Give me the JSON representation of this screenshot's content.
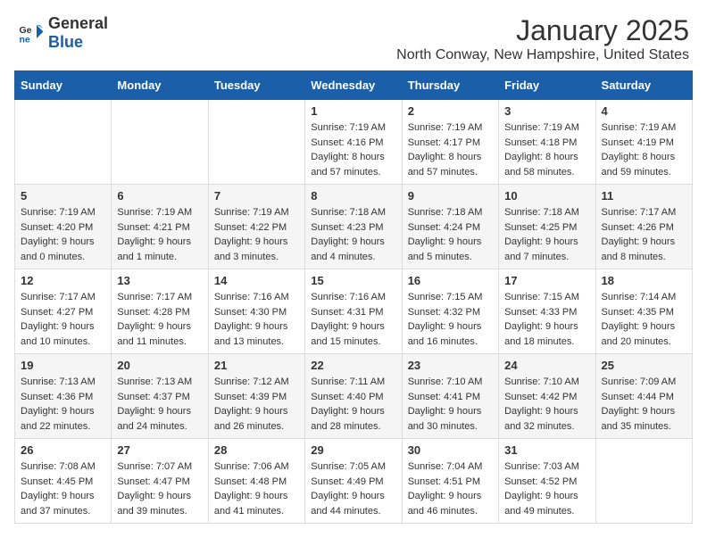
{
  "header": {
    "logo_general": "General",
    "logo_blue": "Blue",
    "month_title": "January 2025",
    "location": "North Conway, New Hampshire, United States"
  },
  "weekdays": [
    "Sunday",
    "Monday",
    "Tuesday",
    "Wednesday",
    "Thursday",
    "Friday",
    "Saturday"
  ],
  "weeks": [
    [
      {
        "day": "",
        "detail": ""
      },
      {
        "day": "",
        "detail": ""
      },
      {
        "day": "",
        "detail": ""
      },
      {
        "day": "1",
        "detail": "Sunrise: 7:19 AM\nSunset: 4:16 PM\nDaylight: 8 hours and 57 minutes."
      },
      {
        "day": "2",
        "detail": "Sunrise: 7:19 AM\nSunset: 4:17 PM\nDaylight: 8 hours and 57 minutes."
      },
      {
        "day": "3",
        "detail": "Sunrise: 7:19 AM\nSunset: 4:18 PM\nDaylight: 8 hours and 58 minutes."
      },
      {
        "day": "4",
        "detail": "Sunrise: 7:19 AM\nSunset: 4:19 PM\nDaylight: 8 hours and 59 minutes."
      }
    ],
    [
      {
        "day": "5",
        "detail": "Sunrise: 7:19 AM\nSunset: 4:20 PM\nDaylight: 9 hours and 0 minutes."
      },
      {
        "day": "6",
        "detail": "Sunrise: 7:19 AM\nSunset: 4:21 PM\nDaylight: 9 hours and 1 minute."
      },
      {
        "day": "7",
        "detail": "Sunrise: 7:19 AM\nSunset: 4:22 PM\nDaylight: 9 hours and 3 minutes."
      },
      {
        "day": "8",
        "detail": "Sunrise: 7:18 AM\nSunset: 4:23 PM\nDaylight: 9 hours and 4 minutes."
      },
      {
        "day": "9",
        "detail": "Sunrise: 7:18 AM\nSunset: 4:24 PM\nDaylight: 9 hours and 5 minutes."
      },
      {
        "day": "10",
        "detail": "Sunrise: 7:18 AM\nSunset: 4:25 PM\nDaylight: 9 hours and 7 minutes."
      },
      {
        "day": "11",
        "detail": "Sunrise: 7:17 AM\nSunset: 4:26 PM\nDaylight: 9 hours and 8 minutes."
      }
    ],
    [
      {
        "day": "12",
        "detail": "Sunrise: 7:17 AM\nSunset: 4:27 PM\nDaylight: 9 hours and 10 minutes."
      },
      {
        "day": "13",
        "detail": "Sunrise: 7:17 AM\nSunset: 4:28 PM\nDaylight: 9 hours and 11 minutes."
      },
      {
        "day": "14",
        "detail": "Sunrise: 7:16 AM\nSunset: 4:30 PM\nDaylight: 9 hours and 13 minutes."
      },
      {
        "day": "15",
        "detail": "Sunrise: 7:16 AM\nSunset: 4:31 PM\nDaylight: 9 hours and 15 minutes."
      },
      {
        "day": "16",
        "detail": "Sunrise: 7:15 AM\nSunset: 4:32 PM\nDaylight: 9 hours and 16 minutes."
      },
      {
        "day": "17",
        "detail": "Sunrise: 7:15 AM\nSunset: 4:33 PM\nDaylight: 9 hours and 18 minutes."
      },
      {
        "day": "18",
        "detail": "Sunrise: 7:14 AM\nSunset: 4:35 PM\nDaylight: 9 hours and 20 minutes."
      }
    ],
    [
      {
        "day": "19",
        "detail": "Sunrise: 7:13 AM\nSunset: 4:36 PM\nDaylight: 9 hours and 22 minutes."
      },
      {
        "day": "20",
        "detail": "Sunrise: 7:13 AM\nSunset: 4:37 PM\nDaylight: 9 hours and 24 minutes."
      },
      {
        "day": "21",
        "detail": "Sunrise: 7:12 AM\nSunset: 4:39 PM\nDaylight: 9 hours and 26 minutes."
      },
      {
        "day": "22",
        "detail": "Sunrise: 7:11 AM\nSunset: 4:40 PM\nDaylight: 9 hours and 28 minutes."
      },
      {
        "day": "23",
        "detail": "Sunrise: 7:10 AM\nSunset: 4:41 PM\nDaylight: 9 hours and 30 minutes."
      },
      {
        "day": "24",
        "detail": "Sunrise: 7:10 AM\nSunset: 4:42 PM\nDaylight: 9 hours and 32 minutes."
      },
      {
        "day": "25",
        "detail": "Sunrise: 7:09 AM\nSunset: 4:44 PM\nDaylight: 9 hours and 35 minutes."
      }
    ],
    [
      {
        "day": "26",
        "detail": "Sunrise: 7:08 AM\nSunset: 4:45 PM\nDaylight: 9 hours and 37 minutes."
      },
      {
        "day": "27",
        "detail": "Sunrise: 7:07 AM\nSunset: 4:47 PM\nDaylight: 9 hours and 39 minutes."
      },
      {
        "day": "28",
        "detail": "Sunrise: 7:06 AM\nSunset: 4:48 PM\nDaylight: 9 hours and 41 minutes."
      },
      {
        "day": "29",
        "detail": "Sunrise: 7:05 AM\nSunset: 4:49 PM\nDaylight: 9 hours and 44 minutes."
      },
      {
        "day": "30",
        "detail": "Sunrise: 7:04 AM\nSunset: 4:51 PM\nDaylight: 9 hours and 46 minutes."
      },
      {
        "day": "31",
        "detail": "Sunrise: 7:03 AM\nSunset: 4:52 PM\nDaylight: 9 hours and 49 minutes."
      },
      {
        "day": "",
        "detail": ""
      }
    ]
  ]
}
